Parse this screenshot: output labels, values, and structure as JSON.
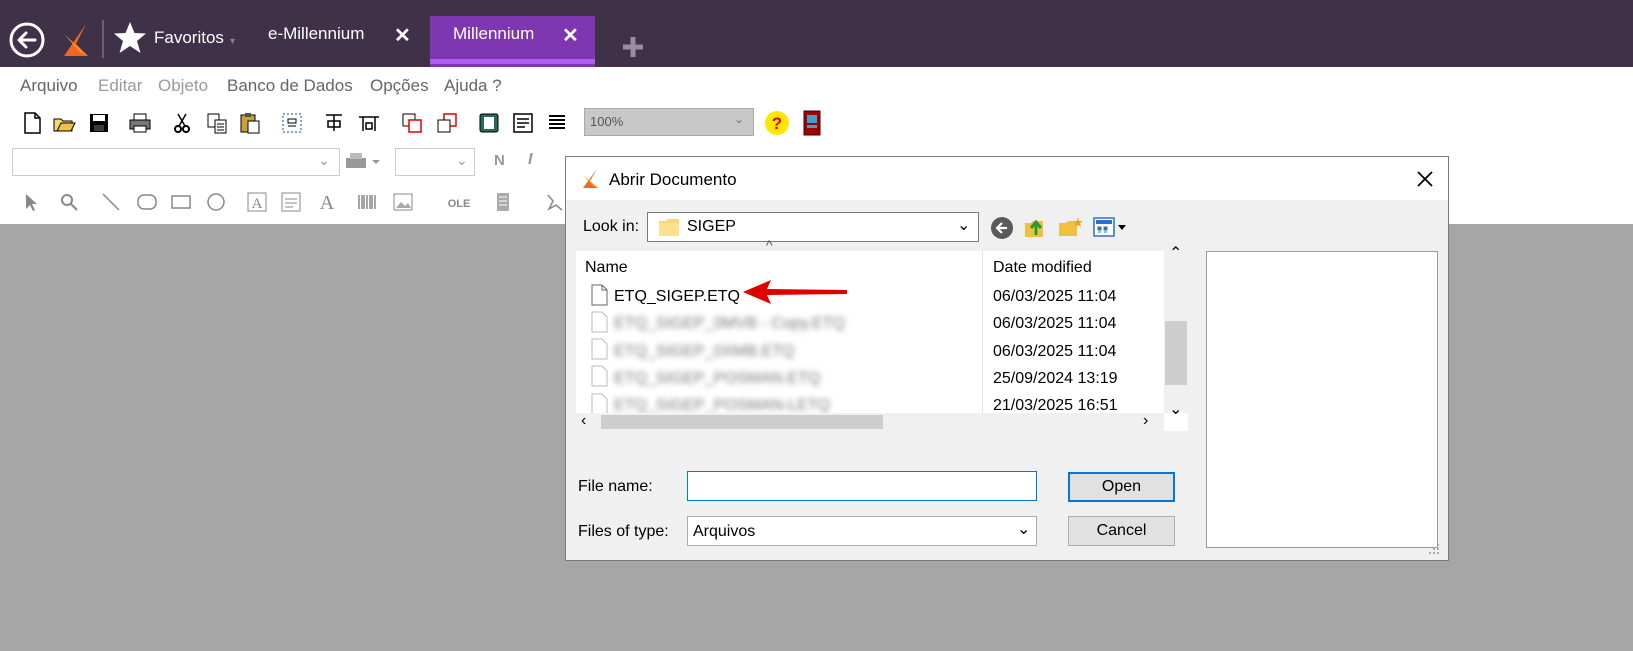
{
  "tabs": {
    "favorites_label": "Favoritos",
    "items": [
      {
        "label": "e-Millennium",
        "active": false
      },
      {
        "label": "Millennium",
        "active": true
      }
    ]
  },
  "menu": [
    "Arquivo",
    "Editar",
    "Objeto",
    "Banco de Dados",
    "Opções",
    "Ajuda ?"
  ],
  "toolbar": {
    "zoom": "100%"
  },
  "dialog": {
    "title": "Abrir Documento",
    "look_in_label": "Look in:",
    "look_in_value": "SIGEP",
    "columns": {
      "name": "Name",
      "date": "Date modified"
    },
    "files": [
      {
        "name": "ETQ_SIGEP.ETQ",
        "date": "06/03/2025 11:04"
      },
      {
        "name": "ETQ_SIGEP_0MVB - Copy.ETQ",
        "date": "06/03/2025 11:04"
      },
      {
        "name": "ETQ_SIGEP_0XMB.ETQ",
        "date": "06/03/2025 11:04"
      },
      {
        "name": "ETQ_SIGEP_POSMAN.ETQ",
        "date": "25/09/2024 13:19"
      },
      {
        "name": "ETQ_SIGEP_POSMAN-LETQ",
        "date": "21/03/2025 16:51"
      }
    ],
    "file_name_label": "File name:",
    "file_name_value": "",
    "files_of_type_label": "Files of type:",
    "files_of_type_value": "Arquivos",
    "open_label": "Open",
    "cancel_label": "Cancel"
  },
  "colors": {
    "titlebar": "#3f3148",
    "active_tab": "#7e37b0",
    "accent": "#0078d7",
    "arrow": "#e00000"
  }
}
